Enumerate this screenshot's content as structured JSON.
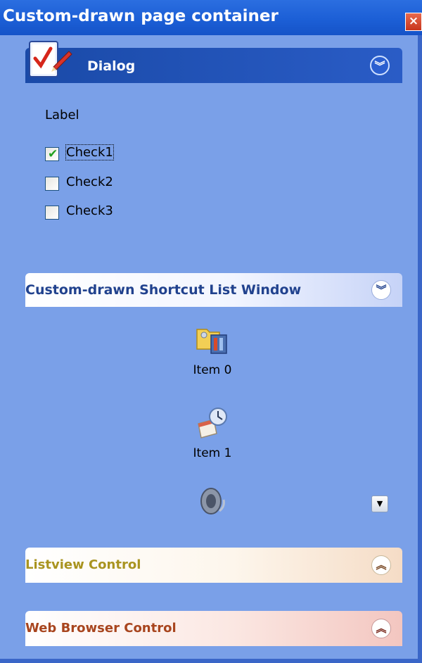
{
  "window": {
    "title": "Custom-drawn page container",
    "close_label": "×"
  },
  "dialog_panel": {
    "title": "Dialog",
    "label": "Label",
    "checks": [
      {
        "label": "Check1",
        "checked": true,
        "focused": true
      },
      {
        "label": "Check2",
        "checked": false,
        "focused": false
      },
      {
        "label": "Check3",
        "checked": false,
        "focused": false
      }
    ]
  },
  "shortcut_panel": {
    "title": "Custom-drawn Shortcut List Window",
    "items": [
      {
        "label": "Item 0",
        "icon": "folder-tools-icon"
      },
      {
        "label": "Item 1",
        "icon": "calendar-clock-icon"
      },
      {
        "label": "",
        "icon": "speaker-icon"
      }
    ]
  },
  "listview_panel": {
    "title": "Listview Control"
  },
  "webbrowser_panel": {
    "title": "Web Browser Control"
  },
  "colors": {
    "title_bar": "#1c5fd6",
    "background": "#7aa0e8",
    "dialog_header": "#1a4aa8",
    "shortcut_title": "#21428e",
    "listview_title": "#a99420",
    "webbrowser_title": "#a8451e"
  }
}
